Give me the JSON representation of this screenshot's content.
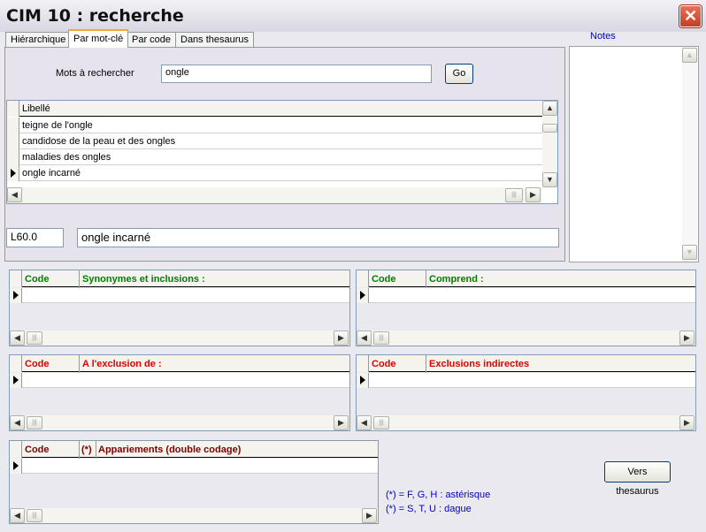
{
  "window": {
    "title": "CIM 10 : recherche",
    "close_glyph": "✕"
  },
  "tabs": [
    "Hiérarchique",
    "Par mot-clé",
    "Par code",
    "Dans thesaurus"
  ],
  "search": {
    "label": "Mots à rechercher",
    "value": "ongle",
    "go_label": "Go"
  },
  "results": {
    "header": "Libellé",
    "rows": [
      "teigne de l'ongle",
      "candidose de la peau et des ongles",
      "maladies des ongles",
      "ongle incarné"
    ],
    "selected_index": 3
  },
  "selection": {
    "code": "L60.0",
    "label": "ongle incarné"
  },
  "notes": {
    "title": "Notes"
  },
  "panels": {
    "synonyms": {
      "code_header": "Code",
      "title": "Synonymes et inclusions :",
      "color": "#008000"
    },
    "comprend": {
      "code_header": "Code",
      "title": "Comprend :",
      "color": "#008000"
    },
    "exclusion": {
      "code_header": "Code",
      "title": "A l'exclusion de :",
      "color": "#e00000"
    },
    "indirect": {
      "code_header": "Code",
      "title": "Exclusions indirectes",
      "color": "#e00000"
    },
    "appariements": {
      "code_header": "Code",
      "star_header": "(*)",
      "title": "Appariements (double codage)",
      "color": "#800000"
    }
  },
  "thesaurus_button": "Vers thesaurus",
  "legend": [
    "(*) =  F, G, H : astérisque",
    "(*) = S, T, U : dague"
  ],
  "icons": {
    "row_indicator": "row-pointer-icon",
    "scroll_left": "arrow-left-icon",
    "scroll_right": "arrow-right-icon",
    "scroll_up": "arrow-up-icon",
    "scroll_down": "arrow-down-icon"
  }
}
